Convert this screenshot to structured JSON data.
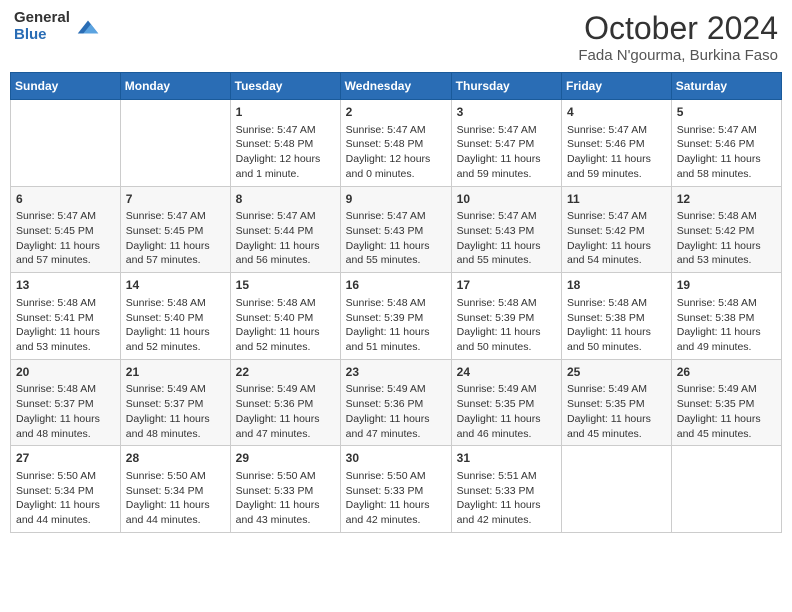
{
  "logo": {
    "general": "General",
    "blue": "Blue"
  },
  "title": "October 2024",
  "location": "Fada N'gourma, Burkina Faso",
  "days": [
    "Sunday",
    "Monday",
    "Tuesday",
    "Wednesday",
    "Thursday",
    "Friday",
    "Saturday"
  ],
  "weeks": [
    [
      {
        "date": "",
        "sunrise": "",
        "sunset": "",
        "daylight": ""
      },
      {
        "date": "",
        "sunrise": "",
        "sunset": "",
        "daylight": ""
      },
      {
        "date": "1",
        "sunrise": "Sunrise: 5:47 AM",
        "sunset": "Sunset: 5:48 PM",
        "daylight": "Daylight: 12 hours and 1 minute."
      },
      {
        "date": "2",
        "sunrise": "Sunrise: 5:47 AM",
        "sunset": "Sunset: 5:48 PM",
        "daylight": "Daylight: 12 hours and 0 minutes."
      },
      {
        "date": "3",
        "sunrise": "Sunrise: 5:47 AM",
        "sunset": "Sunset: 5:47 PM",
        "daylight": "Daylight: 11 hours and 59 minutes."
      },
      {
        "date": "4",
        "sunrise": "Sunrise: 5:47 AM",
        "sunset": "Sunset: 5:46 PM",
        "daylight": "Daylight: 11 hours and 59 minutes."
      },
      {
        "date": "5",
        "sunrise": "Sunrise: 5:47 AM",
        "sunset": "Sunset: 5:46 PM",
        "daylight": "Daylight: 11 hours and 58 minutes."
      }
    ],
    [
      {
        "date": "6",
        "sunrise": "Sunrise: 5:47 AM",
        "sunset": "Sunset: 5:45 PM",
        "daylight": "Daylight: 11 hours and 57 minutes."
      },
      {
        "date": "7",
        "sunrise": "Sunrise: 5:47 AM",
        "sunset": "Sunset: 5:45 PM",
        "daylight": "Daylight: 11 hours and 57 minutes."
      },
      {
        "date": "8",
        "sunrise": "Sunrise: 5:47 AM",
        "sunset": "Sunset: 5:44 PM",
        "daylight": "Daylight: 11 hours and 56 minutes."
      },
      {
        "date": "9",
        "sunrise": "Sunrise: 5:47 AM",
        "sunset": "Sunset: 5:43 PM",
        "daylight": "Daylight: 11 hours and 55 minutes."
      },
      {
        "date": "10",
        "sunrise": "Sunrise: 5:47 AM",
        "sunset": "Sunset: 5:43 PM",
        "daylight": "Daylight: 11 hours and 55 minutes."
      },
      {
        "date": "11",
        "sunrise": "Sunrise: 5:47 AM",
        "sunset": "Sunset: 5:42 PM",
        "daylight": "Daylight: 11 hours and 54 minutes."
      },
      {
        "date": "12",
        "sunrise": "Sunrise: 5:48 AM",
        "sunset": "Sunset: 5:42 PM",
        "daylight": "Daylight: 11 hours and 53 minutes."
      }
    ],
    [
      {
        "date": "13",
        "sunrise": "Sunrise: 5:48 AM",
        "sunset": "Sunset: 5:41 PM",
        "daylight": "Daylight: 11 hours and 53 minutes."
      },
      {
        "date": "14",
        "sunrise": "Sunrise: 5:48 AM",
        "sunset": "Sunset: 5:40 PM",
        "daylight": "Daylight: 11 hours and 52 minutes."
      },
      {
        "date": "15",
        "sunrise": "Sunrise: 5:48 AM",
        "sunset": "Sunset: 5:40 PM",
        "daylight": "Daylight: 11 hours and 52 minutes."
      },
      {
        "date": "16",
        "sunrise": "Sunrise: 5:48 AM",
        "sunset": "Sunset: 5:39 PM",
        "daylight": "Daylight: 11 hours and 51 minutes."
      },
      {
        "date": "17",
        "sunrise": "Sunrise: 5:48 AM",
        "sunset": "Sunset: 5:39 PM",
        "daylight": "Daylight: 11 hours and 50 minutes."
      },
      {
        "date": "18",
        "sunrise": "Sunrise: 5:48 AM",
        "sunset": "Sunset: 5:38 PM",
        "daylight": "Daylight: 11 hours and 50 minutes."
      },
      {
        "date": "19",
        "sunrise": "Sunrise: 5:48 AM",
        "sunset": "Sunset: 5:38 PM",
        "daylight": "Daylight: 11 hours and 49 minutes."
      }
    ],
    [
      {
        "date": "20",
        "sunrise": "Sunrise: 5:48 AM",
        "sunset": "Sunset: 5:37 PM",
        "daylight": "Daylight: 11 hours and 48 minutes."
      },
      {
        "date": "21",
        "sunrise": "Sunrise: 5:49 AM",
        "sunset": "Sunset: 5:37 PM",
        "daylight": "Daylight: 11 hours and 48 minutes."
      },
      {
        "date": "22",
        "sunrise": "Sunrise: 5:49 AM",
        "sunset": "Sunset: 5:36 PM",
        "daylight": "Daylight: 11 hours and 47 minutes."
      },
      {
        "date": "23",
        "sunrise": "Sunrise: 5:49 AM",
        "sunset": "Sunset: 5:36 PM",
        "daylight": "Daylight: 11 hours and 47 minutes."
      },
      {
        "date": "24",
        "sunrise": "Sunrise: 5:49 AM",
        "sunset": "Sunset: 5:35 PM",
        "daylight": "Daylight: 11 hours and 46 minutes."
      },
      {
        "date": "25",
        "sunrise": "Sunrise: 5:49 AM",
        "sunset": "Sunset: 5:35 PM",
        "daylight": "Daylight: 11 hours and 45 minutes."
      },
      {
        "date": "26",
        "sunrise": "Sunrise: 5:49 AM",
        "sunset": "Sunset: 5:35 PM",
        "daylight": "Daylight: 11 hours and 45 minutes."
      }
    ],
    [
      {
        "date": "27",
        "sunrise": "Sunrise: 5:50 AM",
        "sunset": "Sunset: 5:34 PM",
        "daylight": "Daylight: 11 hours and 44 minutes."
      },
      {
        "date": "28",
        "sunrise": "Sunrise: 5:50 AM",
        "sunset": "Sunset: 5:34 PM",
        "daylight": "Daylight: 11 hours and 44 minutes."
      },
      {
        "date": "29",
        "sunrise": "Sunrise: 5:50 AM",
        "sunset": "Sunset: 5:33 PM",
        "daylight": "Daylight: 11 hours and 43 minutes."
      },
      {
        "date": "30",
        "sunrise": "Sunrise: 5:50 AM",
        "sunset": "Sunset: 5:33 PM",
        "daylight": "Daylight: 11 hours and 42 minutes."
      },
      {
        "date": "31",
        "sunrise": "Sunrise: 5:51 AM",
        "sunset": "Sunset: 5:33 PM",
        "daylight": "Daylight: 11 hours and 42 minutes."
      },
      {
        "date": "",
        "sunrise": "",
        "sunset": "",
        "daylight": ""
      },
      {
        "date": "",
        "sunrise": "",
        "sunset": "",
        "daylight": ""
      }
    ]
  ]
}
